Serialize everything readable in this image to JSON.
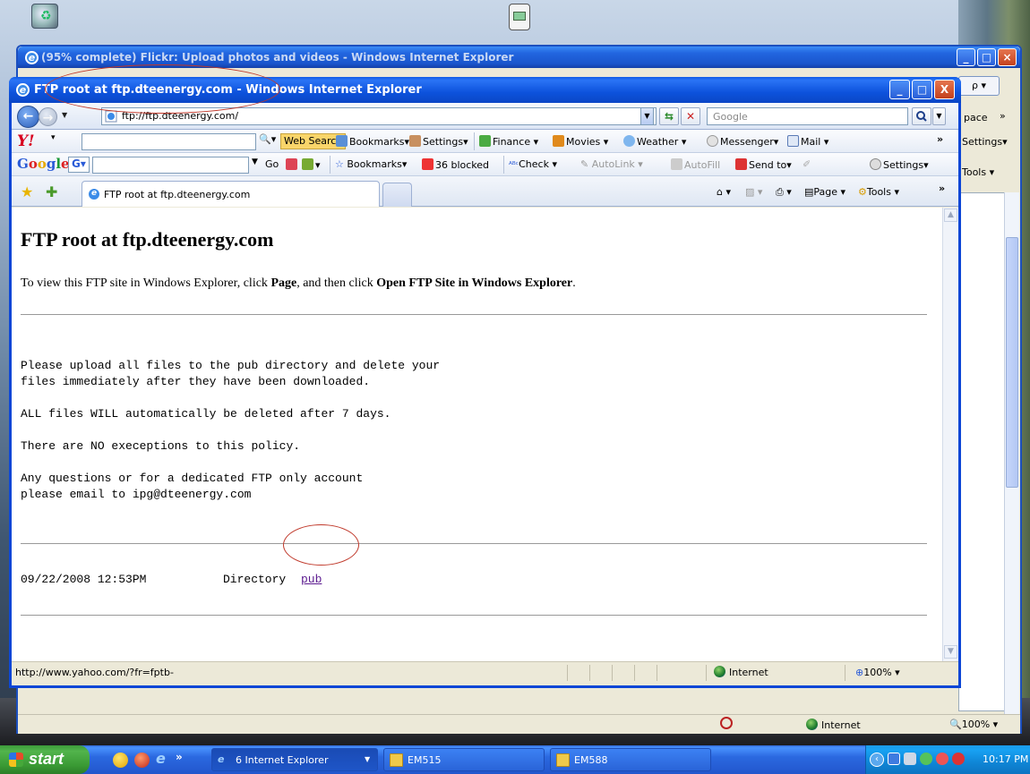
{
  "background_window": {
    "title": "(95% complete) Flickr: Upload photos and videos - Windows Internet Explorer",
    "search_button": "ρ",
    "strip": {
      "space": "pace",
      "more": "»",
      "settings": "Settings",
      "tools": "Tools"
    },
    "status": {
      "zone": "Internet",
      "zoom": "100%"
    }
  },
  "window": {
    "title": "FTP root at ftp.dteenergy.com - Windows Internet Explorer",
    "controls": {
      "minimize": "_",
      "maximize": "□",
      "close": "X"
    }
  },
  "address_bar": {
    "url": "ftp://ftp.dteenergy.com/",
    "search_placeholder": "Google"
  },
  "yahoo_toolbar": {
    "logo": "Y!",
    "web_search": "Web Search",
    "items": [
      "Bookmarks",
      "Settings",
      "Finance",
      "Movies",
      "Weather",
      "Messenger",
      "Mail"
    ],
    "more": "»"
  },
  "google_toolbar": {
    "logo": [
      "G",
      "o",
      "o",
      "g",
      "l",
      "e"
    ],
    "g_button": "G",
    "go": "Go",
    "bookmarks": "Bookmarks",
    "blocked": "36 blocked",
    "check": "Check",
    "autolink": "AutoLink",
    "autofill": "AutoFill",
    "send_to": "Send to",
    "settings": "Settings",
    "more": "»"
  },
  "tabs": {
    "active": "FTP root at ftp.dteenergy.com",
    "commands": {
      "page": "Page",
      "tools": "Tools",
      "more": "»"
    }
  },
  "page": {
    "heading": "FTP root at ftp.dteenergy.com",
    "instruction": {
      "part1": "To view this FTP site in Windows Explorer, click ",
      "bold1": "Page",
      "part2": ", and then click ",
      "bold2": "Open FTP Site in Windows Explorer",
      "part3": "."
    },
    "message_lines": [
      "Please upload all files to the pub directory and delete your",
      "files immediately after they have been downloaded.",
      "ALL files WILL automatically be deleted after 7 days.",
      "There are NO execeptions to this policy.",
      "Any questions or for a dedicated FTP only account",
      "please email to ipg@dteenergy.com"
    ],
    "listing": {
      "date": "09/22/2008 12:53PM",
      "type": "Directory",
      "name": "pub"
    }
  },
  "status_bar": {
    "text": "http://www.yahoo.com/?fr=fptb-",
    "zone": "Internet",
    "zoom": "100%"
  },
  "taskbar": {
    "start": "start",
    "quicklaunch_more": "»",
    "buttons": [
      {
        "label": "6 Internet Explorer"
      },
      {
        "label": "EM515"
      },
      {
        "label": "EM588"
      }
    ],
    "clock": "10:17 PM"
  }
}
